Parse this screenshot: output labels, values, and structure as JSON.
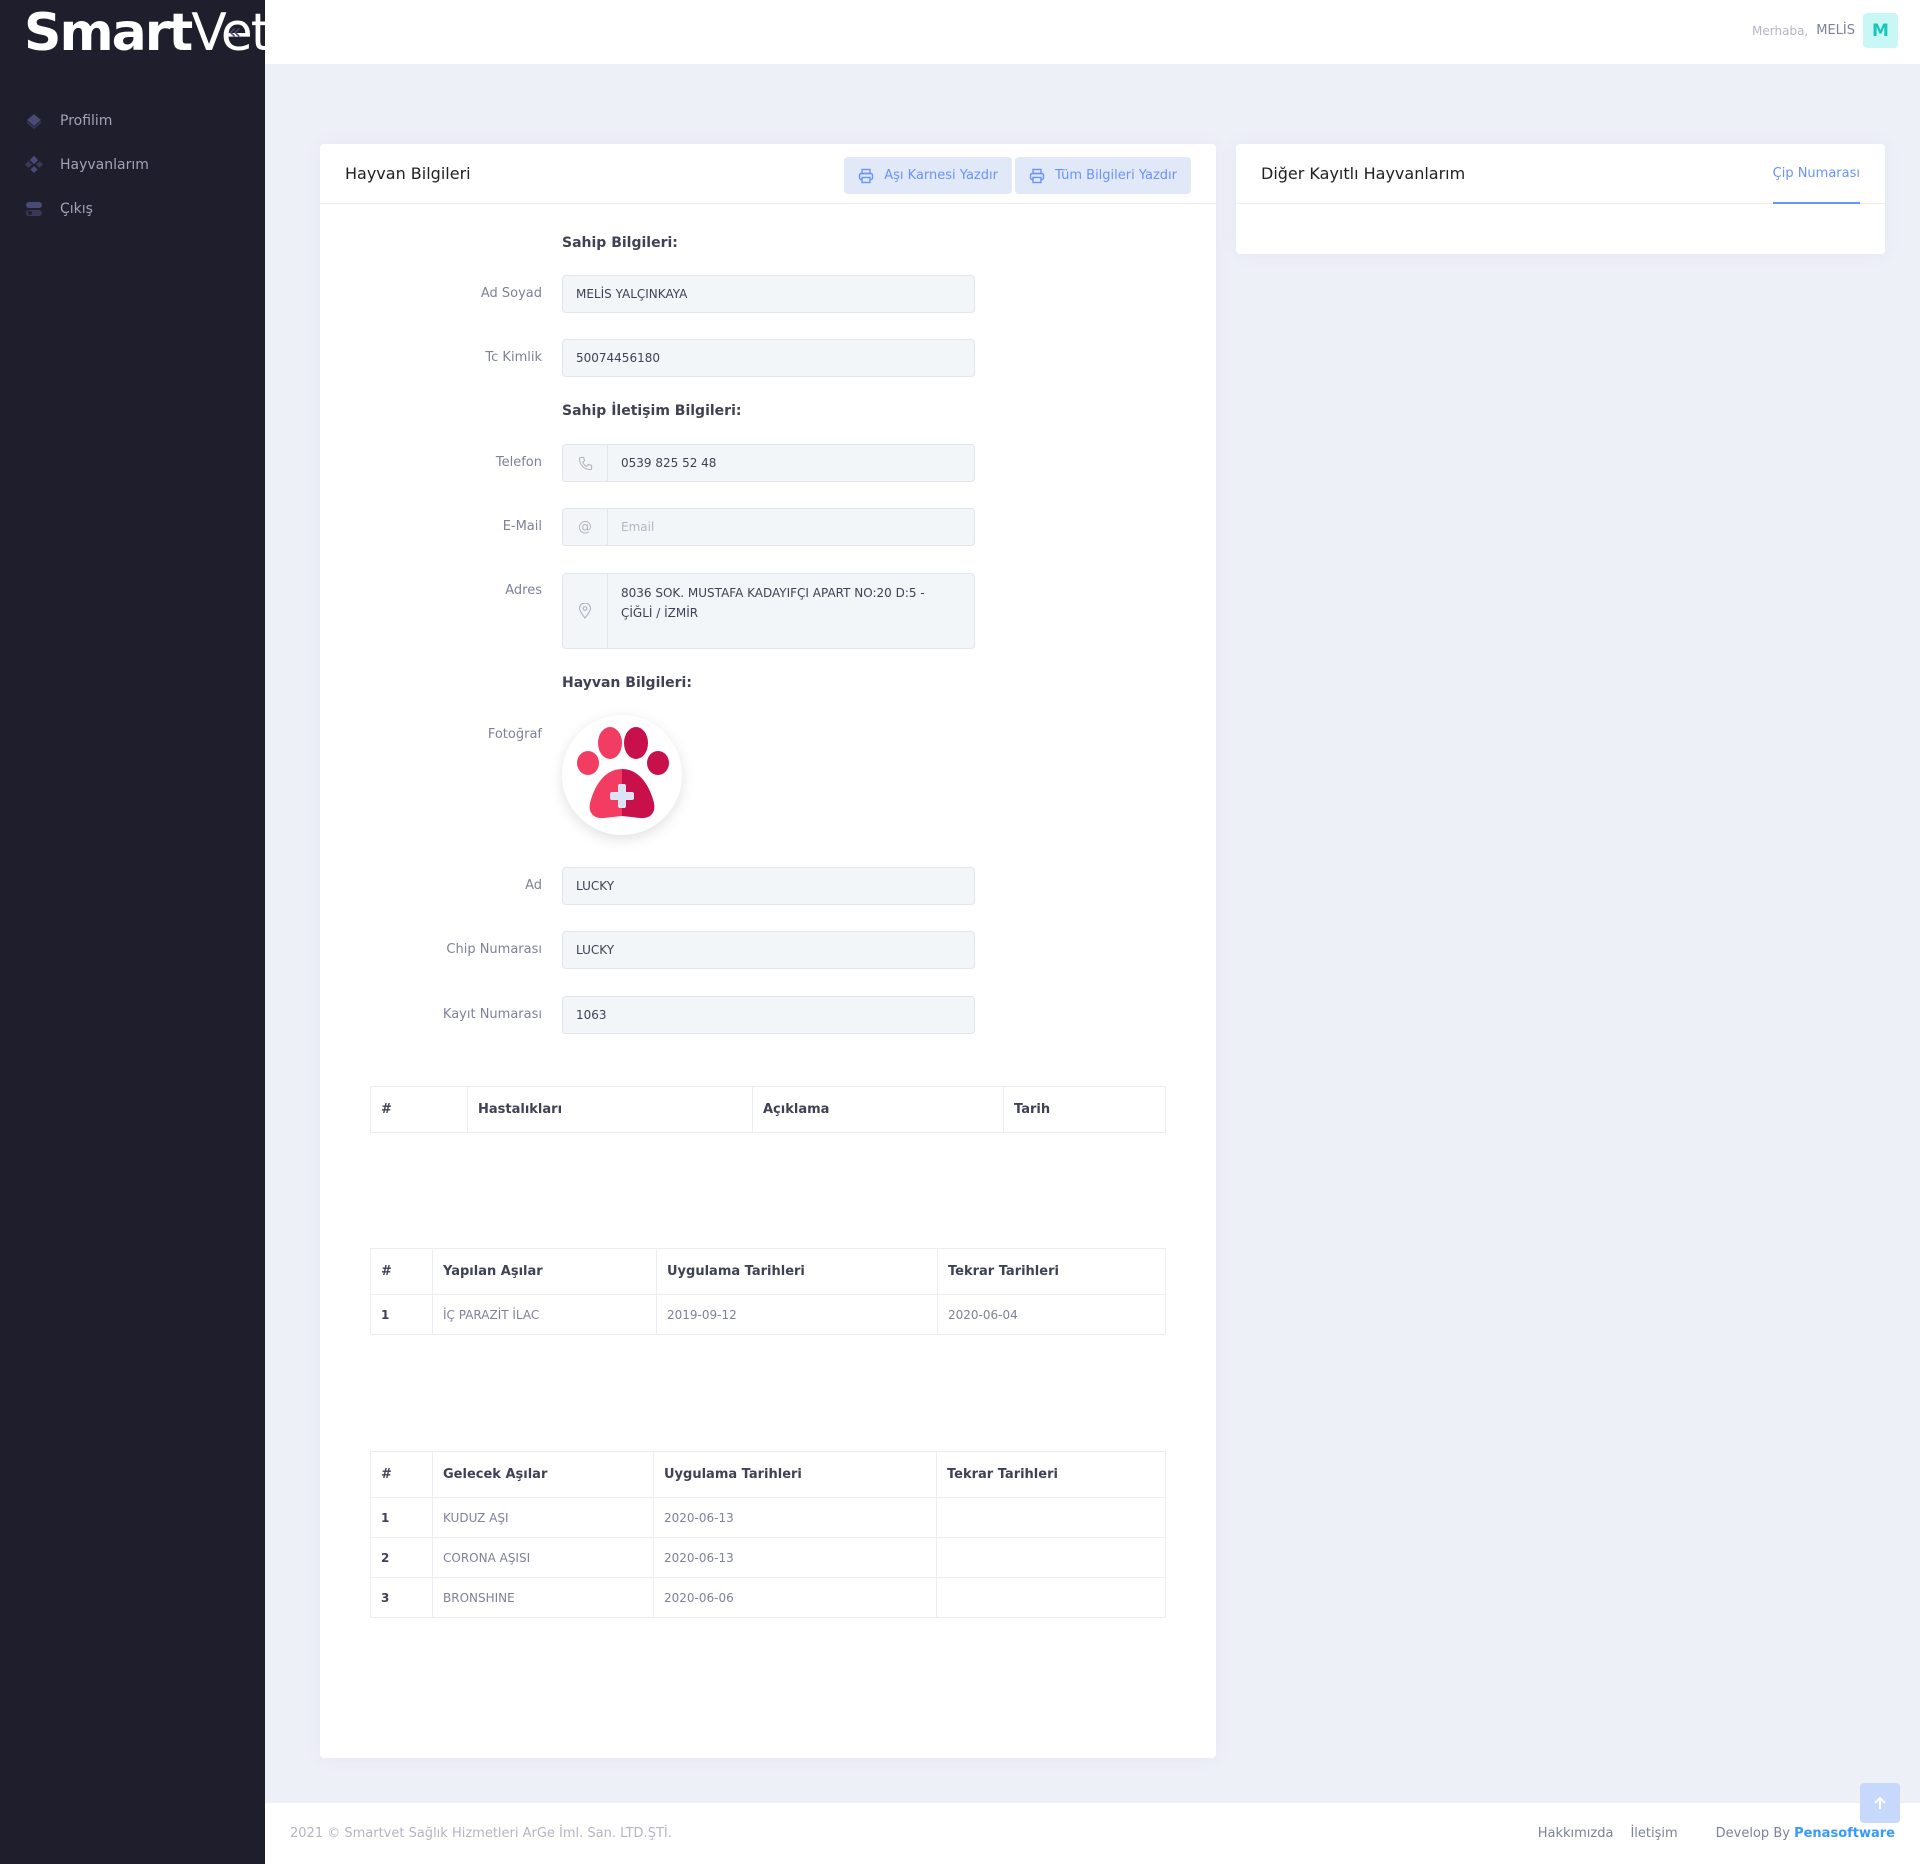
{
  "brand": {
    "name_bold": "Smart",
    "name_thin": "Vet"
  },
  "sidebar": {
    "items": [
      {
        "label": "Profilim",
        "icon": "diamond-icon"
      },
      {
        "label": "Hayvanlarım",
        "icon": "paw-icon"
      },
      {
        "label": "Çıkış",
        "icon": "toggle-icon"
      }
    ]
  },
  "header": {
    "greeting": "Merhaba,",
    "user_name": "MELİS",
    "avatar_letter": "M"
  },
  "main_card": {
    "title": "Hayvan Bilgileri",
    "print_vaccine_label": "Aşı Karnesi Yazdır",
    "print_all_label": "Tüm Bilgileri Yazdır"
  },
  "side_card": {
    "title": "Diğer Kayıtlı Hayvanlarım",
    "tab_label": "Çip Numarası"
  },
  "owner": {
    "section_title": "Sahip Bilgileri:",
    "name_label": "Ad Soyad",
    "name_value": "MELİS YALÇINKAYA",
    "tc_label": "Tc Kimlik",
    "tc_value": "50074456180"
  },
  "contact": {
    "section_title": "Sahip İletişim Bilgileri:",
    "phone_label": "Telefon",
    "phone_value": "0539 825 52 48",
    "email_label": "E-Mail",
    "email_placeholder": "Email",
    "address_label": "Adres",
    "address_line1": "8036 SOK. MUSTAFA KADAYIFÇI APART NO:20 D:5 -",
    "address_line2": "ÇİĞLİ / İZMİR"
  },
  "animal": {
    "section_title": "Hayvan Bilgileri:",
    "photo_label": "Fotoğraf",
    "name_label": "Ad",
    "name_value": "LUCKY",
    "chip_label": "Chip Numarası",
    "chip_value": "LUCKY",
    "reg_label": "Kayıt Numarası",
    "reg_value": "1063"
  },
  "diseases_table": {
    "headers": [
      "#",
      "Hastalıkları",
      "Açıklama",
      "Tarih"
    ]
  },
  "done_vaccines_table": {
    "headers": [
      "#",
      "Yapılan Aşılar",
      "Uygulama Tarihleri",
      "Tekrar Tarihleri"
    ],
    "rows": [
      [
        "1",
        "İÇ PARAZİT İLAC",
        "2019-09-12",
        "2020-06-04"
      ]
    ]
  },
  "future_vaccines_table": {
    "headers": [
      "#",
      "Gelecek Aşılar",
      "Uygulama Tarihleri",
      "Tekrar Tarihleri"
    ],
    "rows": [
      [
        "1",
        "KUDUZ AŞI",
        "2020-06-13",
        ""
      ],
      [
        "2",
        "CORONA AŞISI",
        "2020-06-13",
        ""
      ],
      [
        "3",
        "BRONSHINE",
        "2020-06-06",
        ""
      ]
    ]
  },
  "footer": {
    "copyright": "2021 © Smartvet Sağlık Hizmetleri ArGe İml. San. LTD.ŞTİ.",
    "about": "Hakkımızda",
    "contact": "İletişim",
    "develop_by": "Develop By",
    "developer": "Penasoftware"
  },
  "colors": {
    "sidebar_bg": "#1e1e2d",
    "accent": "#6993ff",
    "page_bg": "#eef0f8"
  }
}
